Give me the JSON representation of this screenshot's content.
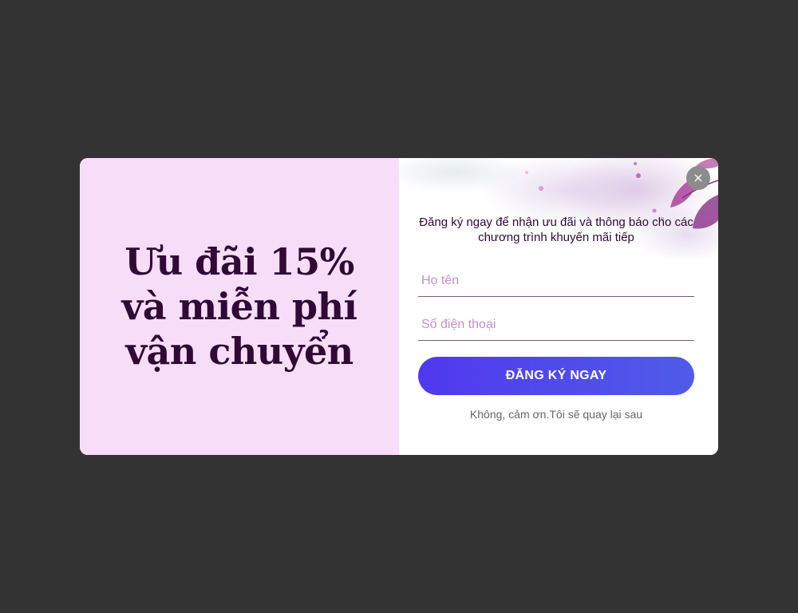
{
  "popup": {
    "headline": "Ưu đãi 15% và miễn phí vận chuyển",
    "subtitle": "Đăng ký ngay để nhận ưu đãi và thông báo cho các chương trình khuyến mãi tiếp",
    "close_icon": "×",
    "name_placeholder": "Họ tên",
    "phone_placeholder": "Số điện thoại",
    "submit_label": "ĐĂNG KÝ NGAY",
    "dismiss_label": "Không, cảm ơn.Tôi sẽ quay lại sau"
  },
  "colors": {
    "backdrop": "#333333",
    "left_panel": "#f8ddf9",
    "headline_text": "#2e0a35",
    "button_start": "#5138ee",
    "button_end": "#4f5ce8",
    "placeholder": "#c48fc8"
  },
  "icons": {
    "close": "close-icon",
    "decoration": "watercolor-leaves-icon"
  }
}
